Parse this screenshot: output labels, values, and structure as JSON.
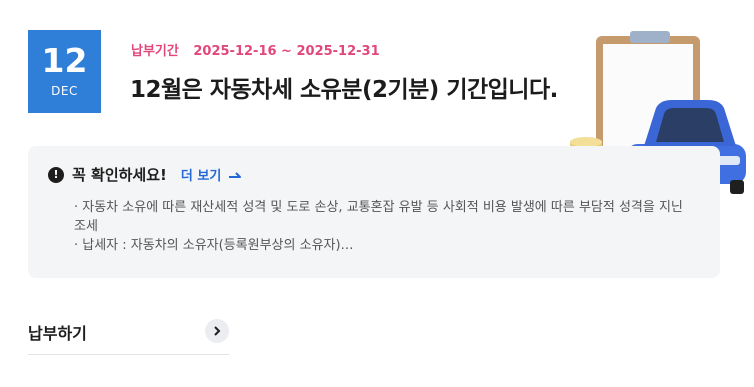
{
  "date": {
    "day": "12",
    "month": "DEC"
  },
  "period": {
    "label": "납부기간",
    "range": "2025-12-16 ~ 2025-12-31"
  },
  "headline": "12월은 자동차세 소유분(2기분) 기간입니다.",
  "notice": {
    "icon": "!",
    "title": "꼭 확인하세요!",
    "more_label": "더 보기",
    "items": [
      "· 자동차 소유에 따른 재산세적 성격 및 도로 손상, 교통혼잡 유발 등 사회적 비용 발생에 따른 부담적 성격을 지닌 조세",
      "· 납세자 : 자동차의 소유자(등록원부상의 소유자)…"
    ]
  },
  "pay": {
    "label": "납부하기"
  },
  "colors": {
    "accent": "#2f7fd8",
    "period": "#e2477a",
    "link": "#2468d6",
    "car": "#3f6fe0"
  }
}
